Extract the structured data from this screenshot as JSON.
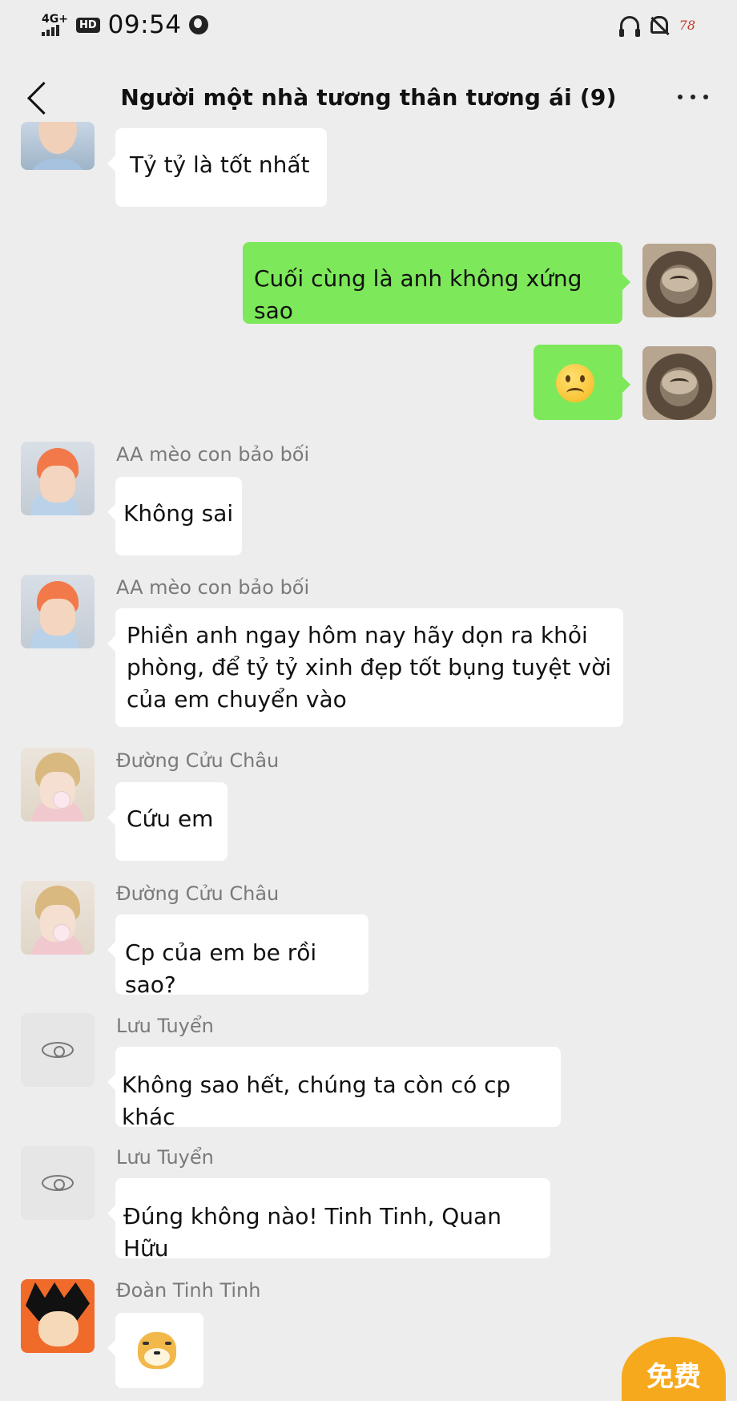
{
  "status_bar": {
    "network": "4G+",
    "hd": "HD",
    "time": "09:54",
    "battery": "78"
  },
  "header": {
    "title": "Người một nhà tương thân tương ái (9)"
  },
  "messages": [
    {
      "direction": "in",
      "sender": "",
      "avatar": "girl-avatar",
      "text": "Tỷ tỷ là tốt nhất"
    },
    {
      "direction": "out",
      "sender": "",
      "avatar": "cat-avatar",
      "text": "Cuối cùng là anh không xứng sao"
    },
    {
      "direction": "out",
      "sender": "",
      "avatar": "cat-avatar",
      "text": "",
      "emoji": "frowning-face-emoji"
    },
    {
      "direction": "in",
      "sender": "AA mèo con bảo bối",
      "avatar": "orange-hair-avatar",
      "text": "Không sai"
    },
    {
      "direction": "in",
      "sender": "AA mèo con bảo bối",
      "avatar": "orange-hair-avatar",
      "lines": [
        "Phiền anh ngay hôm nay hãy dọn ra khỏi",
        "phòng, để tỷ tỷ xinh đẹp tốt bụng tuyệt vời",
        "của em chuyển vào"
      ]
    },
    {
      "direction": "in",
      "sender": "Đường Cửu Châu",
      "avatar": "blonde-avatar",
      "text": "Cứu em"
    },
    {
      "direction": "in",
      "sender": "Đường Cửu Châu",
      "avatar": "blonde-avatar",
      "text": "Cp của em be rồi sao?"
    },
    {
      "direction": "in",
      "sender": "Lưu Tuyển",
      "avatar": "eye-avatar",
      "text": "Không sao hết, chúng ta còn có cp khác"
    },
    {
      "direction": "in",
      "sender": "Lưu Tuyển",
      "avatar": "eye-avatar",
      "text": "Đúng không nào! Tinh Tinh, Quan Hữu"
    },
    {
      "direction": "in",
      "sender": "Đoàn Tinh Tinh",
      "avatar": "goku-avatar",
      "text": "",
      "emoji": "doge-sticker"
    }
  ],
  "promo": {
    "label": "免费"
  },
  "colors": {
    "background": "#ededed",
    "outgoing_bubble": "#95ec69",
    "incoming_bubble": "#ffffff"
  }
}
